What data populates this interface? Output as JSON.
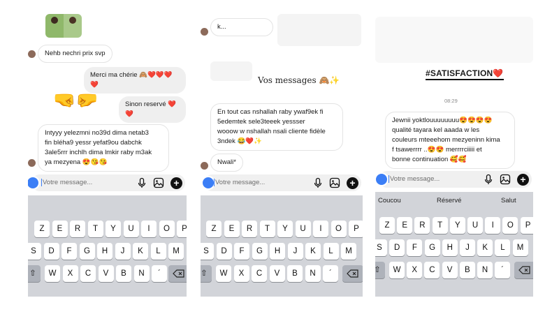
{
  "panel1": {
    "messages": [
      {
        "text": "Nehb nechri prix svp"
      },
      {
        "text": "Merci ma chérie 🙈❤️❤️❤️❤️"
      },
      {
        "text": "Sinon reservé ❤️❤️"
      },
      {
        "line1": "Intyyy yelezmni no39d dima netab3",
        "line2": "fin bléha9 yessr yefat9ou dabchk",
        "line3": "3ale5rrr inchlh dima lmkir raby m3ak",
        "line4": "ya mezyena 😍😘😘"
      }
    ],
    "composer_placeholder": "Votre message...",
    "keyboard_rows": [
      [
        "Z",
        "E",
        "R",
        "T",
        "Y",
        "U",
        "I",
        "O",
        "P"
      ],
      [
        "S",
        "D",
        "F",
        "G",
        "H",
        "J",
        "K",
        "L",
        "M"
      ],
      [
        "W",
        "X",
        "C",
        "V",
        "B",
        "N",
        "´"
      ]
    ]
  },
  "panel2": {
    "top_fragment": "k...",
    "banner": "Vos messages 🙈✨",
    "messages": [
      {
        "line1": "En tout cas nshallah raby ywaf9ek fi",
        "line2": "5edemtek sele3teeek yessser",
        "line3": "wooow w nshallah nsali cliente fidèle",
        "line4": "3ndek 😂❤️✨"
      },
      {
        "text": "Nwali*"
      }
    ],
    "composer_placeholder": "Votre message...",
    "keyboard_rows": [
      [
        "Z",
        "E",
        "R",
        "T",
        "Y",
        "U",
        "I",
        "O",
        "P"
      ],
      [
        "S",
        "D",
        "F",
        "G",
        "H",
        "J",
        "K",
        "L",
        "M"
      ],
      [
        "W",
        "X",
        "C",
        "V",
        "B",
        "N",
        "´"
      ]
    ]
  },
  "panel3": {
    "hashtag": "#SATISFACTION❤️",
    "timestamp": "08:29",
    "messages": [
      {
        "line1": "Jewnii yoktlouuuuuuuu😍😍😍😍",
        "line2": "qualité tayara kel aaada w les",
        "line3": "couleurs mteeehom mezyeninn kima",
        "line4": "f tsawerrrr ..😍😍 merrrrciiiii et",
        "line5": "bonne continuation 🥰🥰"
      }
    ],
    "composer_placeholder": "Votre message...",
    "suggestions": [
      "Coucou",
      "Réservé",
      "Salut"
    ],
    "keyboard_rows": [
      [
        "Z",
        "E",
        "R",
        "T",
        "Y",
        "U",
        "I",
        "O",
        "P"
      ],
      [
        "S",
        "D",
        "F",
        "G",
        "H",
        "J",
        "K",
        "L",
        "M"
      ],
      [
        "W",
        "X",
        "C",
        "V",
        "B",
        "N",
        "´"
      ]
    ]
  },
  "icons": [
    "camera-icon",
    "microphone-icon",
    "gallery-icon",
    "plus-icon",
    "backspace-icon",
    "handshake-emoji"
  ],
  "colors": {
    "accent_blue": "#3b7ef6",
    "heart_red": "#e0283b",
    "keyboard_bg": "#d2d4d9",
    "bubble_out": "#efefef"
  }
}
